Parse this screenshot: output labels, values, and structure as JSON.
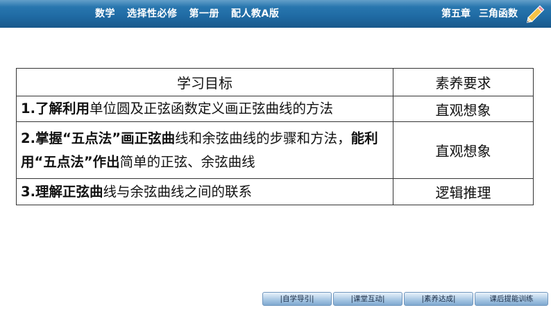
{
  "header": {
    "left_items": [
      "数学",
      "选择性必修",
      "第一册",
      "配人教A版"
    ],
    "chapter": "第五章",
    "chapter_title": "三角函数",
    "bar_color": "#1f6aa3",
    "icon": "pencil-icon"
  },
  "table": {
    "col_goal_header": "学习目标",
    "col_req_header": "素养要求",
    "rows": [
      {
        "goal_bold_a": "1.了解利用",
        "goal_rest_a": "单位圆及正弦函数定义画正弦曲线的方法",
        "goal_bold_b": "",
        "goal_rest_b": "",
        "requirement": "直观想象"
      },
      {
        "goal_bold_a": "2.掌握“五点法”画正弦曲",
        "goal_rest_a": "线和余弦曲线的步骤和方法，",
        "goal_bold_b": "能利用“五点法”作出",
        "goal_rest_b": "简单的正弦、余弦曲线",
        "requirement": "直观想象"
      },
      {
        "goal_bold_a": "3.理解正弦曲",
        "goal_rest_a": "线与余弦曲线之间的联系",
        "goal_bold_b": "",
        "goal_rest_b": "",
        "requirement": "逻辑推理"
      }
    ]
  },
  "nav": {
    "buttons": [
      "|自学导引|",
      "|课堂互动|",
      "|素养达成|",
      "课后提能训练"
    ]
  }
}
